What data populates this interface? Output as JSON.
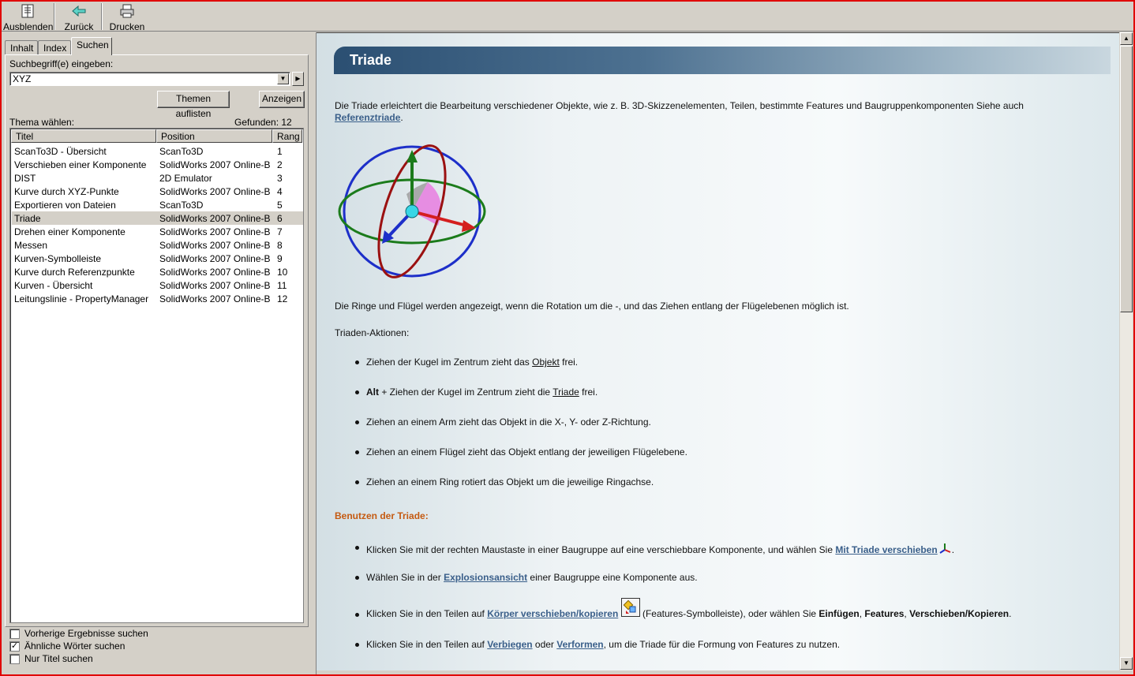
{
  "toolbar": {
    "hide_label": "Ausblenden",
    "back_label": "Zurück",
    "print_label": "Drucken"
  },
  "tabs": [
    {
      "label": "Inhalt"
    },
    {
      "label": "Index"
    },
    {
      "label": "Suchen"
    }
  ],
  "search": {
    "prompt_label": "Suchbegriff(e) eingeben:",
    "value": "XYZ",
    "list_topics_button": "Themen auflisten",
    "display_button": "Anzeigen",
    "choose_topic_label": "Thema wählen:",
    "found_label": "Gefunden: 12"
  },
  "results": {
    "columns": [
      "Titel",
      "Position",
      "Rang"
    ],
    "selected_index": 5,
    "rows": [
      {
        "title": "ScanTo3D - Übersicht",
        "position": "ScanTo3D",
        "rank": "1"
      },
      {
        "title": "Verschieben einer Komponente",
        "position": "SolidWorks 2007 Online-B...",
        "rank": "2"
      },
      {
        "title": "DIST",
        "position": "2D Emulator",
        "rank": "3"
      },
      {
        "title": "Kurve durch XYZ-Punkte",
        "position": "SolidWorks 2007 Online-B...",
        "rank": "4"
      },
      {
        "title": "Exportieren von Dateien",
        "position": "ScanTo3D",
        "rank": "5"
      },
      {
        "title": "Triade",
        "position": "SolidWorks 2007 Online-B...",
        "rank": "6"
      },
      {
        "title": "Drehen einer Komponente",
        "position": "SolidWorks 2007 Online-B...",
        "rank": "7"
      },
      {
        "title": "Messen",
        "position": "SolidWorks 2007 Online-B...",
        "rank": "8"
      },
      {
        "title": "Kurven-Symbolleiste",
        "position": "SolidWorks 2007 Online-B...",
        "rank": "9"
      },
      {
        "title": "Kurve durch Referenzpunkte",
        "position": "SolidWorks 2007 Online-B...",
        "rank": "10"
      },
      {
        "title": "Kurven - Übersicht",
        "position": "SolidWorks 2007 Online-B...",
        "rank": "11"
      },
      {
        "title": "Leitungslinie - PropertyManager",
        "position": "SolidWorks 2007 Online-B...",
        "rank": "12"
      }
    ]
  },
  "options": [
    {
      "label": "Vorherige Ergebnisse suchen",
      "checked": false
    },
    {
      "label": "Ähnliche Wörter suchen",
      "checked": true
    },
    {
      "label": "Nur Titel suchen",
      "checked": false
    }
  ],
  "article": {
    "title": "Triade",
    "intro": "Die Triade erleichtert die Bearbeitung verschiedener Objekte, wie z. B. 3D-Skizzenelementen, Teilen, bestimmte Features und Baugruppenkomponenten Siehe auch",
    "intro_link": "Referenztriade",
    "intro_end": ".",
    "rings_text": "Die Ringe und Flügel werden angezeigt, wenn die Rotation um die -, und das Ziehen entlang der Flügelebenen möglich ist.",
    "actions_heading": "Triaden-Aktionen:",
    "actions": {
      "a1_pre": "Ziehen der Kugel im Zentrum zieht das ",
      "a1_link": "Objekt",
      "a1_post": " frei.",
      "a2_bold": "Alt",
      "a2_pre": " + Ziehen der Kugel im Zentrum zieht die ",
      "a2_link": "Triade",
      "a2_post": " frei.",
      "a3": "Ziehen an einem Arm zieht das Objekt in die X-, Y- oder Z-Richtung.",
      "a4": "Ziehen an einem Flügel zieht das Objekt entlang der jeweiligen Flügelebene.",
      "a5": "Ziehen an einem Ring rotiert das Objekt um die jeweilige Ringachse."
    },
    "usage_heading": "Benutzen der Triade:",
    "usage": {
      "u1_pre": "Klicken Sie mit der rechten Maustaste in einer Baugruppe auf eine verschiebbare Komponente, und wählen Sie ",
      "u1_link": "Mit Triade verschieben",
      "u1_post": ".",
      "u2_pre": "Wählen Sie in der ",
      "u2_link": "Explosionsansicht",
      "u2_post": " einer Baugruppe eine Komponente aus.",
      "u3_pre": "Klicken Sie in den Teilen auf ",
      "u3_link": "Körper verschieben/kopieren",
      "u3_mid": " (Features-Symbolleiste), oder wählen Sie ",
      "u3_b1": "Einfügen",
      "u3_c1": ", ",
      "u3_b2": "Features",
      "u3_c2": ", ",
      "u3_b3": "Verschieben/Kopieren",
      "u3_post": ".",
      "u4_pre": "Klicken Sie in den Teilen auf ",
      "u4_link1": "Verbiegen",
      "u4_mid": " oder ",
      "u4_link2": "Verformen",
      "u4_post": ", um die Triade für die Formung von Features zu nutzen."
    }
  }
}
